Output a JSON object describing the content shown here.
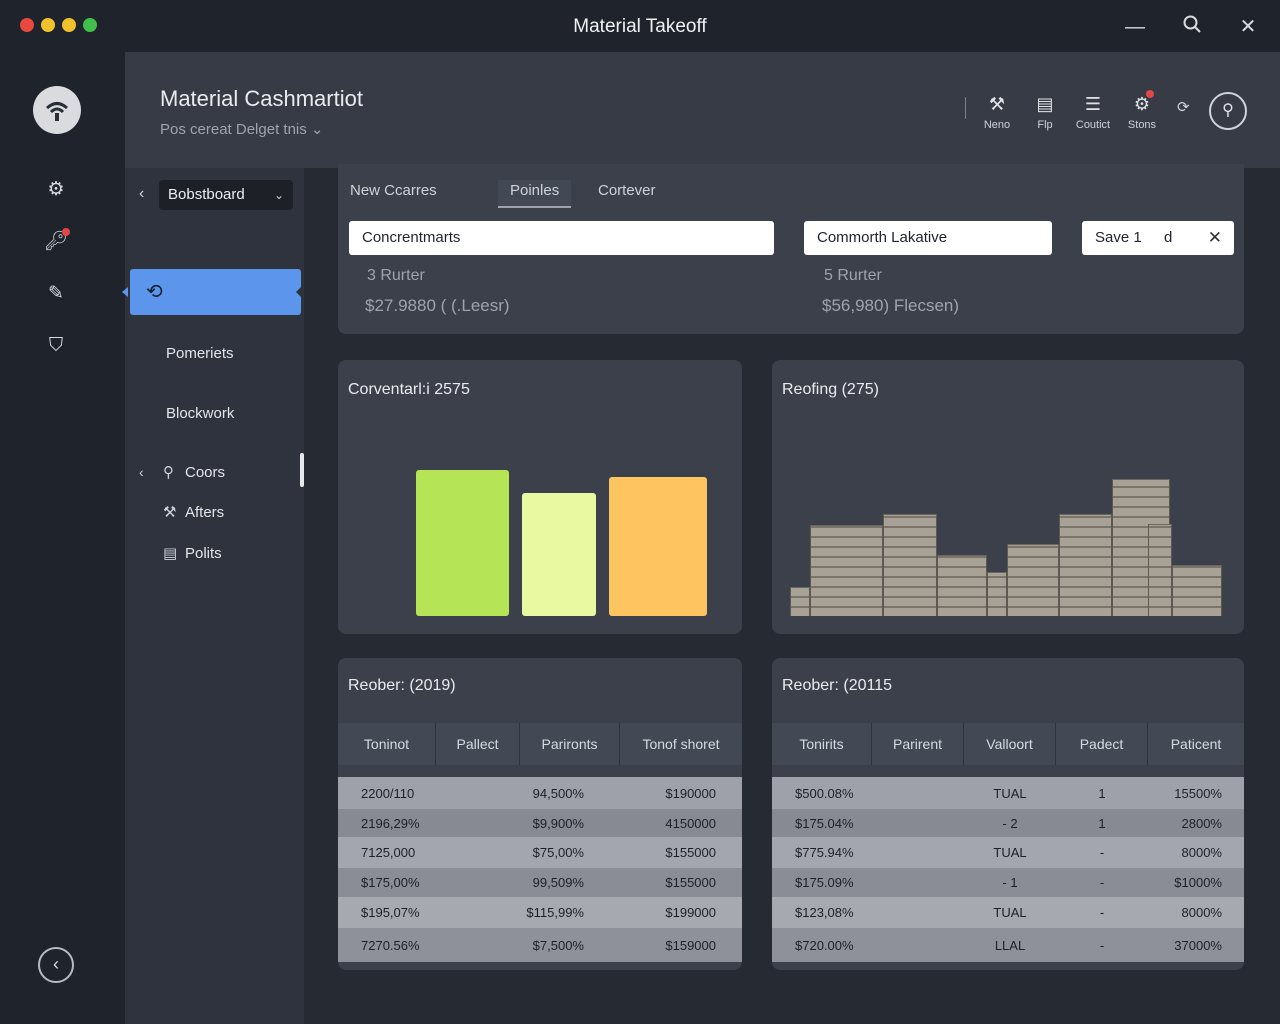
{
  "window": {
    "title": "Material Takeoff",
    "traffic_colors": [
      "#e8493f",
      "#f0c12c",
      "#f0c12c",
      "#40c04a"
    ]
  },
  "rail": {
    "icons": [
      "wifi-logo-icon",
      "gear-icon",
      "key-icon",
      "edit-icon",
      "hat-icon"
    ]
  },
  "header": {
    "title": "Material Cashmartiot",
    "subtitle": "Pos cereat Delget tnis ⌄",
    "actions": [
      {
        "label": "Neno",
        "icon": "hammer-icon"
      },
      {
        "label": "Flp",
        "icon": "document-icon"
      },
      {
        "label": "Coutict",
        "icon": "stack-icon"
      },
      {
        "label": "Stons",
        "icon": "settings-icon"
      }
    ]
  },
  "sidebar": {
    "select_label": "Bobstboard",
    "items": [
      "Pomeriets",
      "Blockwork"
    ],
    "sub_items": [
      {
        "label": "Coors",
        "icon": "search-icon"
      },
      {
        "label": "Afters",
        "icon": "wrench-icon"
      },
      {
        "label": "Polits",
        "icon": "clipboard-icon"
      }
    ]
  },
  "tabs": [
    {
      "label": "New Ccarres",
      "active": false
    },
    {
      "label": "Poinles",
      "active": true
    },
    {
      "label": "Cortever",
      "active": false
    }
  ],
  "fields": {
    "field1": "Concrentmarts",
    "field2": "Commorth Lakative",
    "save_label": "Save 1",
    "save_extra": "d"
  },
  "summary": {
    "left_count": "3 Rurter",
    "left_value": "$27.9880 ( (.Leesr)",
    "right_count": "5 Rurter",
    "right_value": "$56,980) Flecsen)"
  },
  "charts": {
    "left_title": "Corventarl:i 2575",
    "right_title": "Reofing (275)"
  },
  "chart_data": [
    {
      "type": "bar",
      "title": "Corventarl:i 2575",
      "categories": [
        "",
        "",
        ""
      ],
      "values": [
        146,
        123,
        139
      ],
      "colors": [
        "#b5e556",
        "#e9f9a1",
        "#fdc45f"
      ]
    },
    {
      "type": "bar",
      "title": "Reofing (275)",
      "values": [
        29,
        91,
        102,
        61,
        44,
        72,
        102,
        137,
        92,
        51
      ]
    }
  ],
  "tables": {
    "left": {
      "title": "Reober: (2019)",
      "headers": [
        "Toninot",
        "Pallect",
        "Parironts",
        "Tonof shoret"
      ],
      "rows": [
        [
          "2200/110",
          "94,500%",
          "$190000"
        ],
        [
          "2196,29%",
          "$9,900%",
          "4150000"
        ],
        [
          "7125,000",
          "$75,00%",
          "$155000"
        ],
        [
          "$175,00%",
          "99,509%",
          "$155000"
        ],
        [
          "$195,07%",
          "$115,99%",
          "$199000"
        ],
        [
          "7270.56%",
          "$7,500%",
          "$159000"
        ]
      ]
    },
    "right": {
      "title": "Reober: (20115",
      "headers": [
        "Tonirits",
        "Parirent",
        "Valloort",
        "Padect",
        "Paticent"
      ],
      "rows": [
        [
          "$500.08%",
          "TUAL",
          "1",
          "15500%"
        ],
        [
          "$175.04%",
          "- 2",
          "1",
          "2800%"
        ],
        [
          "$775.94%",
          "TUAL",
          "-",
          "8000%"
        ],
        [
          "$175.09%",
          "- 1",
          "-",
          "$1000%"
        ],
        [
          "$123,08%",
          "TUAL",
          "-",
          "8000%"
        ],
        [
          "$720.00%",
          "LLAL",
          "-",
          "37000%"
        ]
      ]
    }
  }
}
